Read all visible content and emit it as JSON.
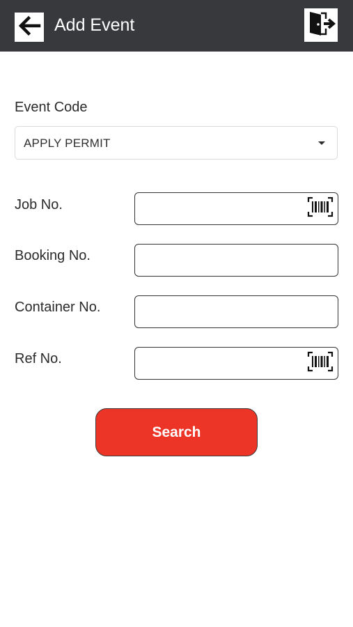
{
  "header": {
    "title": "Add Event",
    "back_icon": "arrow-left-icon",
    "logout_icon": "logout-door-icon",
    "background": "#37393c"
  },
  "form": {
    "event_code": {
      "label": "Event Code",
      "selected": "APPLY PERMIT"
    },
    "job_no": {
      "label": "Job No.",
      "value": "",
      "scan_icon": "barcode-scan-icon"
    },
    "booking_no": {
      "label": "Booking No.",
      "value": ""
    },
    "container_no": {
      "label": "Container No.",
      "value": ""
    },
    "ref_no": {
      "label": "Ref No.",
      "value": "",
      "scan_icon": "barcode-scan-icon"
    }
  },
  "actions": {
    "search_label": "Search",
    "search_color": "#ec3427"
  }
}
